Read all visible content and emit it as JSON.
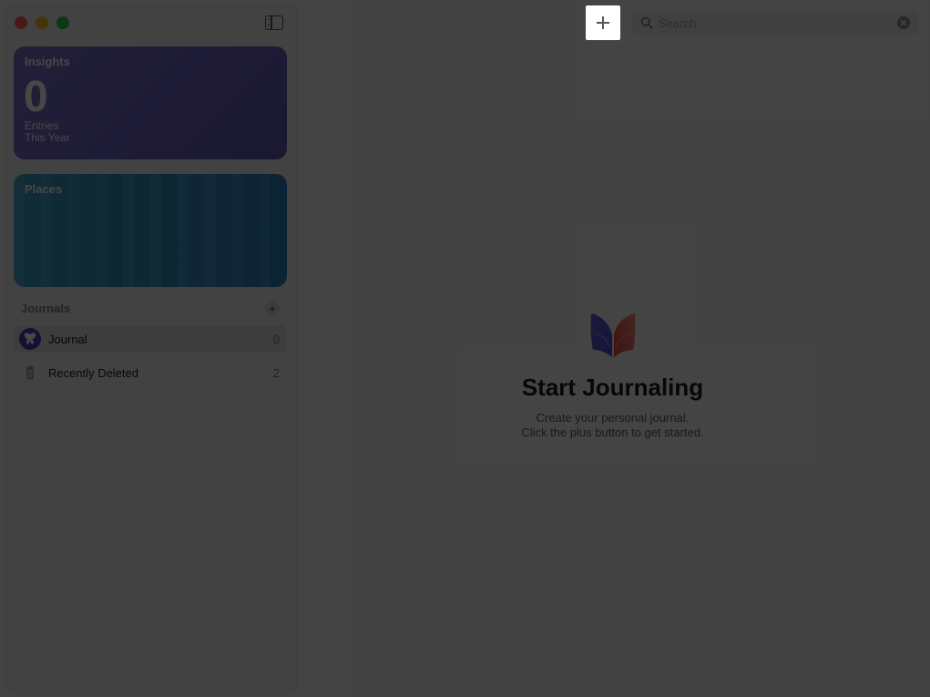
{
  "window": {
    "controls": [
      "close",
      "minimize",
      "zoom"
    ]
  },
  "sidebar": {
    "toggle_icon": "sidebar-toggle-icon",
    "insights": {
      "title": "Insights",
      "count": "0",
      "label_line1": "Entries",
      "label_line2": "This Year"
    },
    "places": {
      "title": "Places"
    },
    "journals_header": "Journals",
    "journals": [
      {
        "label": "Journal",
        "count": "0",
        "icon": "butterfly-icon"
      },
      {
        "label": "Recently Deleted",
        "count": "2",
        "icon": "trash-icon"
      }
    ]
  },
  "toolbar": {
    "new_entry_icon": "plus-icon",
    "search": {
      "placeholder": "Search",
      "value": ""
    }
  },
  "empty_state": {
    "icon": "journal-app-icon",
    "title": "Start Journaling",
    "line1": "Create your personal journal.",
    "line2": "Click the plus button to get started."
  },
  "colors": {
    "insights_card": "#6b5fbf",
    "places_card": "#2f92bd",
    "journal_icon": "#4a3fb3"
  }
}
